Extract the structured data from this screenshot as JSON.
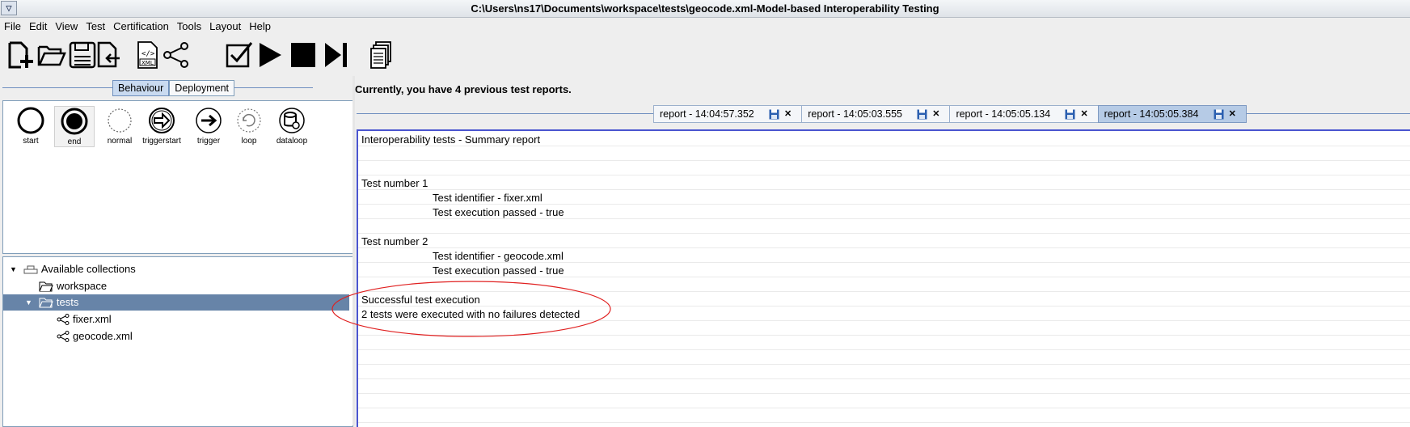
{
  "window": {
    "title": "C:\\Users\\ns17\\Documents\\workspace\\tests\\geocode.xml-Model-based Interoperability Testing"
  },
  "menu": [
    "File",
    "Edit",
    "View",
    "Test",
    "Certification",
    "Tools",
    "Layout",
    "Help"
  ],
  "toolbar": [
    "new-file-icon",
    "open-folder-icon",
    "save-icon",
    "export-icon",
    "xml-icon",
    "share-graph-icon",
    "validate-icon",
    "play-icon",
    "stop-icon",
    "step-forward-icon",
    "copy-documents-icon"
  ],
  "left_tabs": {
    "behaviour": "Behaviour",
    "deployment": "Deployment",
    "active": "Behaviour"
  },
  "palette": [
    "start",
    "end",
    "normal",
    "triggerstart",
    "trigger",
    "loop",
    "dataloop"
  ],
  "tree": {
    "root": "Available collections",
    "workspace": "workspace",
    "tests": "tests",
    "files": [
      "fixer.xml",
      "geocode.xml"
    ]
  },
  "info": "Currently, you have 4 previous test reports.",
  "report_tabs": [
    "report - 14:04:57.352",
    "report - 14:05:03.555",
    "report - 14:05:05.134",
    "report - 14:05:05.384"
  ],
  "report_tabs_active": "report - 14:05:05.384",
  "report": {
    "title": "Interoperability tests - Summary report",
    "tests": [
      {
        "header": "Test number 1",
        "identifier": "Test identifier - fixer.xml",
        "passed": "Test execution passed - true"
      },
      {
        "header": "Test number 2",
        "identifier": "Test identifier - geocode.xml",
        "passed": "Test execution passed - true"
      }
    ],
    "result_title": "Successful test execution",
    "result_detail": "2 tests were executed with no failures detected"
  },
  "colors": {
    "selection": "#6784a8",
    "tab_border": "#7f9db9",
    "annotation": "#e02020"
  }
}
